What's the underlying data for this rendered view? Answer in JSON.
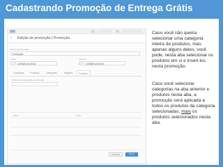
{
  "slide": {
    "title": "Cadastrando Promoção de Entrega Grátis",
    "colors": {
      "background": "#4f97d5",
      "accent": "#3d8fd6"
    }
  },
  "app": {
    "back_icon": "back-arrow-icon",
    "header_title": "Edição de promoção | Promoção",
    "name_label": "Nome da promoção",
    "name_value": "Promoção",
    "start_label": "Início",
    "start_value": "10/05/2015 00:00",
    "end_label": "Término",
    "end_value": "10/05/2015 00:00",
    "tabs": [
      {
        "label": "Condições"
      },
      {
        "label": "Produtos"
      },
      {
        "label": "Categorias"
      },
      {
        "label": "Regiões"
      },
      {
        "label": "Produtos"
      }
    ],
    "list_header": "Produtos da categoria selecionada",
    "col_name": "Nome",
    "col_price": "Preço",
    "cancel_label": "Cancelar",
    "save_label": "Salvar"
  },
  "explanation": {
    "paragraph_1": "Caso você não queira selecionar uma categoria inteira de produtos, mas apenas alguns deles, você pode, nesta aba selecionar os produtos em si e inseri-los nesta promoção.",
    "paragraph_2_before": "Caso você selecione categorias na aba anterior e produtos nesta aba, a promoção será aplicada a todos os produtos da categoria selecionadas, ",
    "paragraph_2_underlined": "mais",
    "paragraph_2_after": " os produtos selecionados nesta aba."
  }
}
